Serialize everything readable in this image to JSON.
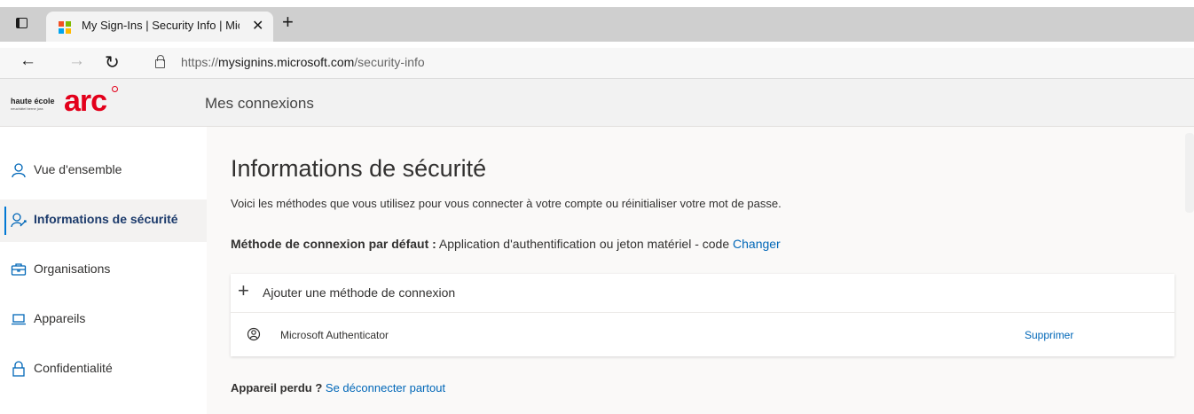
{
  "browser": {
    "tab_title": "My Sign-Ins | Security Info | Micr",
    "url_prefix": "https://",
    "url_domain": "mysignins.microsoft.com",
    "url_path": "/security-info"
  },
  "header": {
    "logo_text": "haute école",
    "logo_subtext": "neuchâtel berne jura",
    "logo_arc": "arc",
    "app_title": "Mes connexions"
  },
  "sidebar": {
    "items": [
      {
        "label": "Vue d'ensemble",
        "icon": "person-icon"
      },
      {
        "label": "Informations de sécurité",
        "icon": "security-info-icon",
        "active": true
      },
      {
        "label": "Organisations",
        "icon": "briefcase-icon"
      },
      {
        "label": "Appareils",
        "icon": "laptop-icon"
      },
      {
        "label": "Confidentialité",
        "icon": "lock-icon"
      }
    ]
  },
  "main": {
    "title": "Informations de sécurité",
    "description": "Voici les méthodes que vous utilisez pour vous connecter à votre compte ou réinitialiser votre mot de passe.",
    "default_method_label": "Méthode de connexion par défaut :",
    "default_method_value": " Application d'authentification ou jeton matériel - code ",
    "change_link": "Changer",
    "add_method_label": "Ajouter une méthode de connexion",
    "methods": [
      {
        "name": "Microsoft Authenticator",
        "action": "Supprimer",
        "icon": "authenticator-icon"
      }
    ],
    "lost_device_label": "Appareil perdu ?",
    "sign_out_everywhere": "Se déconnecter partout"
  },
  "colors": {
    "accent": "#0067b8",
    "active_indicator": "#0078d4",
    "brand_red": "#e3001b"
  }
}
